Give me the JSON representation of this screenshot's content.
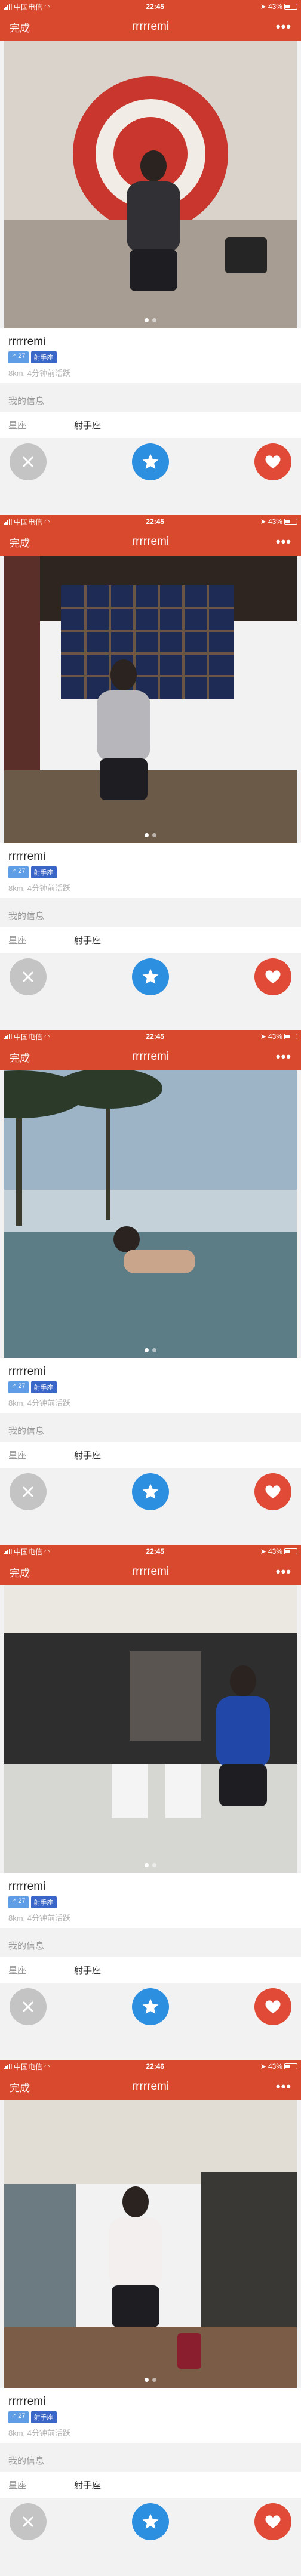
{
  "screens": [
    {
      "status": {
        "carrier": "中国电信",
        "time": "22:45",
        "battery": "43%"
      },
      "nav": {
        "done": "完成",
        "title": "rrrrremi",
        "more": "•••"
      },
      "profile": {
        "name": "rrrrremi",
        "age": "♂ 27",
        "sign": "射手座",
        "meta": "8km, 4分钟前活跃"
      },
      "details": {
        "heading": "我的信息",
        "row_label": "星座",
        "row_value": "射手座"
      }
    },
    {
      "status": {
        "carrier": "中国电信",
        "time": "22:45",
        "battery": "43%"
      },
      "nav": {
        "done": "完成",
        "title": "rrrrremi",
        "more": "•••"
      },
      "profile": {
        "name": "rrrrremi",
        "age": "♂ 27",
        "sign": "射手座",
        "meta": "8km, 4分钟前活跃"
      },
      "details": {
        "heading": "我的信息",
        "row_label": "星座",
        "row_value": "射手座"
      }
    },
    {
      "status": {
        "carrier": "中国电信",
        "time": "22:45",
        "battery": "43%"
      },
      "nav": {
        "done": "完成",
        "title": "rrrrremi",
        "more": "•••"
      },
      "profile": {
        "name": "rrrrremi",
        "age": "♂ 27",
        "sign": "射手座",
        "meta": "8km, 4分钟前活跃"
      },
      "details": {
        "heading": "我的信息",
        "row_label": "星座",
        "row_value": "射手座"
      }
    },
    {
      "status": {
        "carrier": "中国电信",
        "time": "22:45",
        "battery": "43%"
      },
      "nav": {
        "done": "完成",
        "title": "rrrrremi",
        "more": "•••"
      },
      "profile": {
        "name": "rrrrremi",
        "age": "♂ 27",
        "sign": "射手座",
        "meta": "8km, 4分钟前活跃"
      },
      "details": {
        "heading": "我的信息",
        "row_label": "星座",
        "row_value": "射手座"
      }
    },
    {
      "status": {
        "carrier": "中国电信",
        "time": "22:46",
        "battery": "43%"
      },
      "nav": {
        "done": "完成",
        "title": "rrrrremi",
        "more": "•••"
      },
      "profile": {
        "name": "rrrrremi",
        "age": "♂ 27",
        "sign": "射手座",
        "meta": "8km, 4分钟前活跃"
      },
      "details": {
        "heading": "我的信息",
        "row_label": "星座",
        "row_value": "射手座"
      }
    }
  ],
  "icons": {
    "skip": "close-icon",
    "star": "star-icon",
    "like": "heart-icon"
  },
  "colors": {
    "accent": "#d9492d",
    "skip": "#c4c4c4",
    "star": "#2d8fe0",
    "like": "#e04a36"
  }
}
